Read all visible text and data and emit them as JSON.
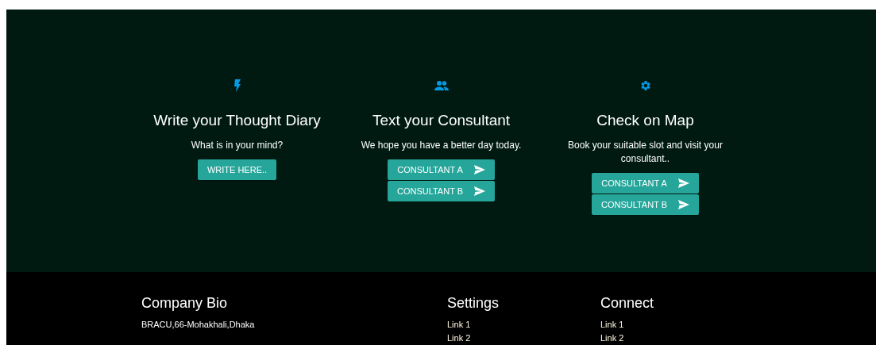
{
  "features": [
    {
      "title": "Write your Thought Diary",
      "text": "What is in your mind?",
      "buttons": [
        {
          "label": "WRITE HERE..",
          "kind": "plain"
        }
      ]
    },
    {
      "title": "Text your Consultant",
      "text": "We hope you have a better day today.",
      "buttons": [
        {
          "label": "CONSULTANT A",
          "kind": "send"
        },
        {
          "label": "CONSULTANT B",
          "kind": "send"
        }
      ]
    },
    {
      "title": "Check on Map",
      "text": "Book your suitable slot and visit your consultant..",
      "buttons": [
        {
          "label": "CONSULTANT A",
          "kind": "send"
        },
        {
          "label": "CONSULTANT B",
          "kind": "send"
        }
      ]
    }
  ],
  "footer": {
    "bio": {
      "title": "Company Bio",
      "text": "BRACU,66-Mohakhali,Dhaka"
    },
    "columns": [
      {
        "title": "Settings",
        "links": [
          "Link 1",
          "Link 2"
        ]
      },
      {
        "title": "Connect",
        "links": [
          "Link 1",
          "Link 2"
        ]
      }
    ]
  }
}
